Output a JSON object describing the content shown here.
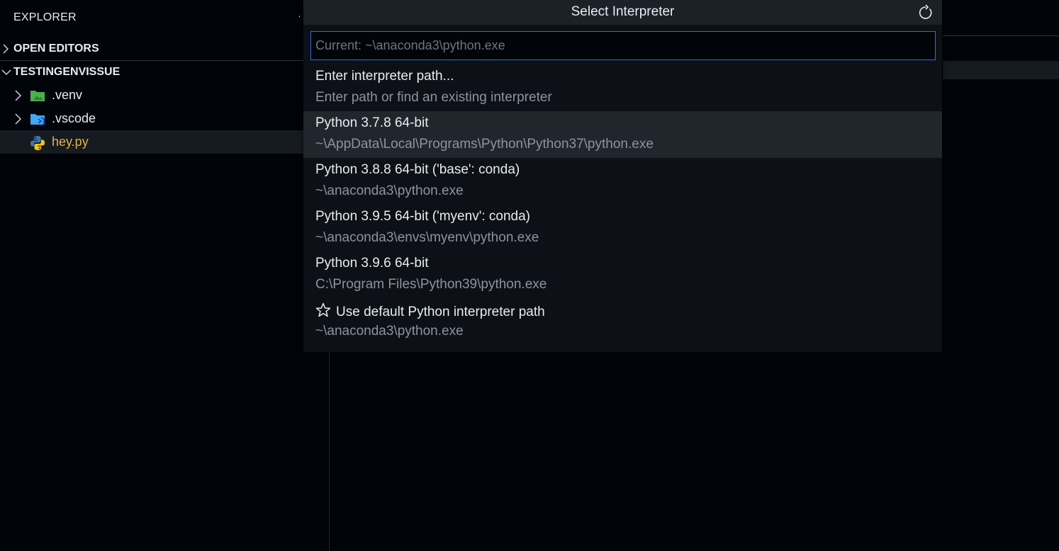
{
  "sidebar": {
    "title": "EXPLORER",
    "more_glyph": "·",
    "sections": {
      "open_editors": "OPEN EDITORS",
      "workspace": "TESTINGENVISSUE"
    },
    "tree": [
      {
        "label": ".venv",
        "icon": "folder-green-icon"
      },
      {
        "label": ".vscode",
        "icon": "folder-vscode-icon"
      },
      {
        "label": "hey.py",
        "icon": "python-icon",
        "color": "#e3b341"
      }
    ]
  },
  "quickpick": {
    "title": "Select Interpreter",
    "refresh_icon": "refresh-icon",
    "input": {
      "value": "",
      "placeholder": "Current: ~\\anaconda3\\python.exe"
    },
    "items": [
      {
        "label": "Enter interpreter path...",
        "description": "Enter path or find an existing interpreter"
      },
      {
        "label": "Python 3.7.8 64-bit",
        "description": "~\\AppData\\Local\\Programs\\Python\\Python37\\python.exe",
        "selected": true
      },
      {
        "label": "Python 3.8.8 64-bit ('base': conda)",
        "description": "~\\anaconda3\\python.exe"
      },
      {
        "label": "Python 3.9.5 64-bit ('myenv': conda)",
        "description": "~\\anaconda3\\envs\\myenv\\python.exe"
      },
      {
        "label": "Python 3.9.6 64-bit",
        "description": "C:\\Program Files\\Python39\\python.exe"
      },
      {
        "label": "Use default Python interpreter path",
        "description": "~\\anaconda3\\python.exe",
        "icon": "star-icon"
      }
    ]
  },
  "colors": {
    "accent_border": "#1f6feb",
    "file_highlight": "#e3b341",
    "background": "#010409"
  }
}
